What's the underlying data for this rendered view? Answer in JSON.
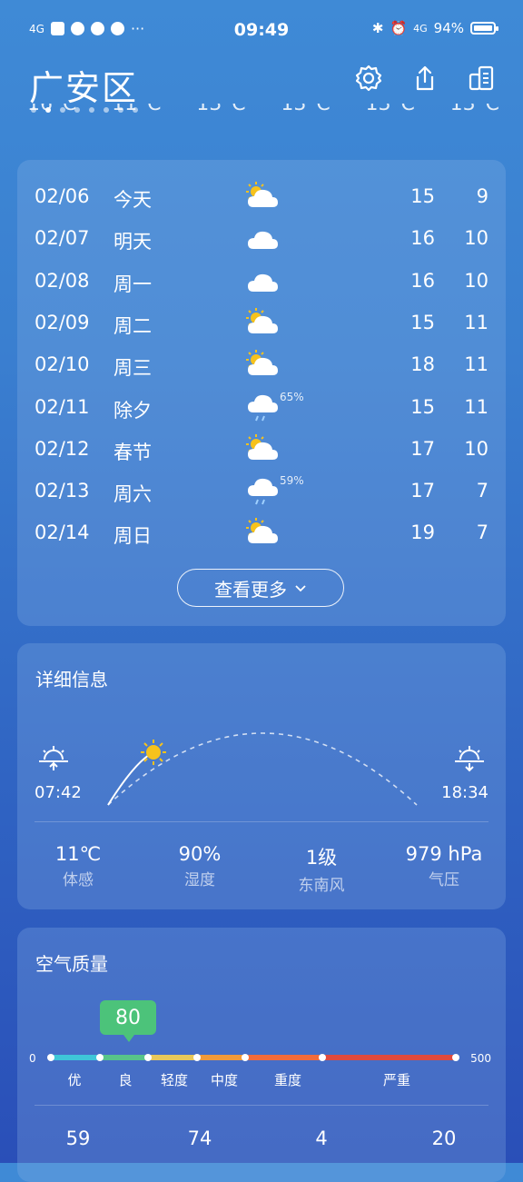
{
  "status_bar": {
    "network": "4G",
    "time": "09:49",
    "right_network": "4G",
    "battery": "94%"
  },
  "header": {
    "city": "广安区"
  },
  "forecast": {
    "rows": [
      {
        "date": "02/06",
        "day": "今天",
        "icon": "partly-cloudy-icon",
        "pop": "",
        "hi": "15",
        "lo": "9"
      },
      {
        "date": "02/07",
        "day": "明天",
        "icon": "cloudy-icon",
        "pop": "",
        "hi": "16",
        "lo": "10"
      },
      {
        "date": "02/08",
        "day": "周一",
        "icon": "cloudy-icon",
        "pop": "",
        "hi": "16",
        "lo": "10"
      },
      {
        "date": "02/09",
        "day": "周二",
        "icon": "partly-cloudy-icon",
        "pop": "",
        "hi": "15",
        "lo": "11"
      },
      {
        "date": "02/10",
        "day": "周三",
        "icon": "partly-cloudy-icon",
        "pop": "",
        "hi": "18",
        "lo": "11"
      },
      {
        "date": "02/11",
        "day": "除夕",
        "icon": "light-rain-icon",
        "pop": "65%",
        "hi": "15",
        "lo": "11"
      },
      {
        "date": "02/12",
        "day": "春节",
        "icon": "partly-cloudy-icon",
        "pop": "",
        "hi": "17",
        "lo": "10"
      },
      {
        "date": "02/13",
        "day": "周六",
        "icon": "light-rain-icon",
        "pop": "59%",
        "hi": "17",
        "lo": "7"
      },
      {
        "date": "02/14",
        "day": "周日",
        "icon": "partly-cloudy-icon",
        "pop": "",
        "hi": "19",
        "lo": "7"
      }
    ],
    "more_label": "查看更多"
  },
  "details": {
    "title": "详细信息",
    "sunrise": "07:42",
    "sunset": "18:34",
    "stats": [
      {
        "value": "11℃",
        "label": "体感"
      },
      {
        "value": "90%",
        "label": "湿度"
      },
      {
        "value": "1级",
        "label": "东南风"
      },
      {
        "value": "979 hPa",
        "label": "气压"
      }
    ]
  },
  "air_quality": {
    "title": "空气质量",
    "aqi": "80",
    "min": "0",
    "max": "500",
    "levels": [
      "优",
      "良",
      "轻度",
      "中度",
      "重度",
      "严重"
    ],
    "pollutants": [
      "59",
      "74",
      "4",
      "20"
    ]
  }
}
